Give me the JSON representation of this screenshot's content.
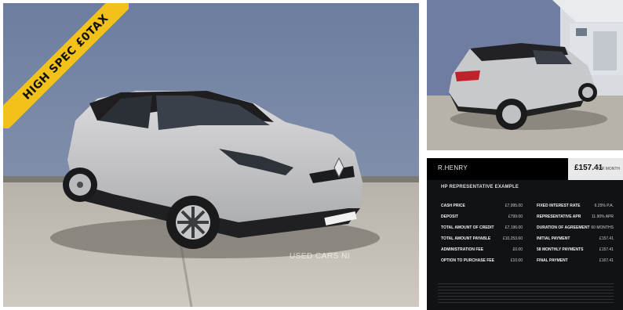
{
  "badge": {
    "text": "HIGH SPEC £0TAX"
  },
  "watermark": {
    "text": "USED CARS NI"
  },
  "colors": {
    "badge": "#f2c21b",
    "car_body": "#c9cacc",
    "wall": "#6f7fa0",
    "panel_bg": "#111214"
  },
  "finance": {
    "dealer_logo": "R.HENRY",
    "monthly_price": "£157.41",
    "per_month": "PER MONTH",
    "title": "HP REPRESENTATIVE EXAMPLE",
    "left_rows": [
      {
        "label": "CASH PRICE",
        "value": "£7,995.00"
      },
      {
        "label": "DEPOSIT",
        "value": "£799.00"
      },
      {
        "label": "TOTAL AMOUNT OF CREDIT",
        "value": "£7,196.00"
      },
      {
        "label": "TOTAL AMOUNT PAYABLE",
        "value": "£10,253.60"
      },
      {
        "label": "ADMINISTRATION FEE",
        "value": "£0.00"
      },
      {
        "label": "OPTION TO PURCHASE FEE",
        "value": "£10.00"
      }
    ],
    "right_rows": [
      {
        "label": "FIXED INTEREST RATE",
        "value": "6.25% P.A."
      },
      {
        "label": "REPRESENTATIVE APR",
        "value": "11.90% APR"
      },
      {
        "label": "DURATION OF AGREEMENT",
        "value": "60 MONTHS"
      },
      {
        "label": "INITIAL PAYMENT",
        "value": "£157.41"
      },
      {
        "label": "58 MONTHLY PAYMENTS",
        "value": "£157.41"
      },
      {
        "label": "FINAL PAYMENT",
        "value": "£167.41"
      }
    ]
  }
}
